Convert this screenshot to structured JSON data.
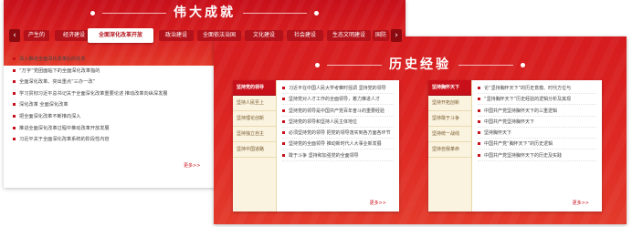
{
  "achievements": {
    "title": "伟大成就",
    "tabs": [
      "产生的",
      "经济建设",
      "全面深化改革开放",
      "政治建设",
      "全面依法治国",
      "文化建设",
      "社会建设",
      "生态文明建设",
      "国防"
    ],
    "prev_arrow": "‹",
    "next_arrow": "›",
    "items": [
      "深入推进全面深化改革后的任务",
      "“万字”党团面临下的全面深化改革指的",
      "全面深化改革、突出重点“三办一改”",
      "学习贯彻习近平总书记关于全面深化改革重要论述 推动改革向纵深发展",
      "深化改革 全面深化改革",
      "把全面深化改革不断推向深入",
      "推进全面深化改革过程中推动改革开放发展",
      "习近平关于全面深化改革系统的阶段性内容"
    ],
    "more": "更多>>"
  },
  "experience": {
    "title": "历史经验",
    "left_card": {
      "tabs": [
        "坚持党的领导",
        "坚持人民至上",
        "坚持理论创新",
        "坚持独立自主",
        "坚持中国道路"
      ],
      "items": [
        "习近平在中国人民大学考察时强调 坚持党的领导",
        "坚持党对人才工作的全面领导，着力推进人才",
        "坚持党的领导是中国共产党百年奋斗的重要经验",
        "坚持党的领导和坚持人民主体地位",
        "必须坚持党的领导 把党的领导落实到各方面各环节",
        "坚持党的全面领导 推动新时代人大事业新发展",
        "敢于斗争 坚持和加强党的全面领导"
      ],
      "more": "更多>>"
    },
    "right_card": {
      "tabs": [
        "坚持胸怀天下",
        "坚持开拓创新",
        "坚持敢于斗争",
        "坚持统一战线",
        "坚持自我革命"
      ],
      "items": [
        "论“坚持胸怀天下”的历史意蕴、时代方位与",
        "“坚持胸怀天下”历史经验的逻辑分析及其现",
        "中国共产党坚持胸怀天下的三重逻辑",
        "中国共产党坚持胸怀天下",
        "坚持胸怀天下",
        "中国共产党“胸怀天下”的历史逻辑",
        "中国共产党坚持胸怀天下的历史及实践"
      ],
      "more": "更多>>"
    }
  }
}
